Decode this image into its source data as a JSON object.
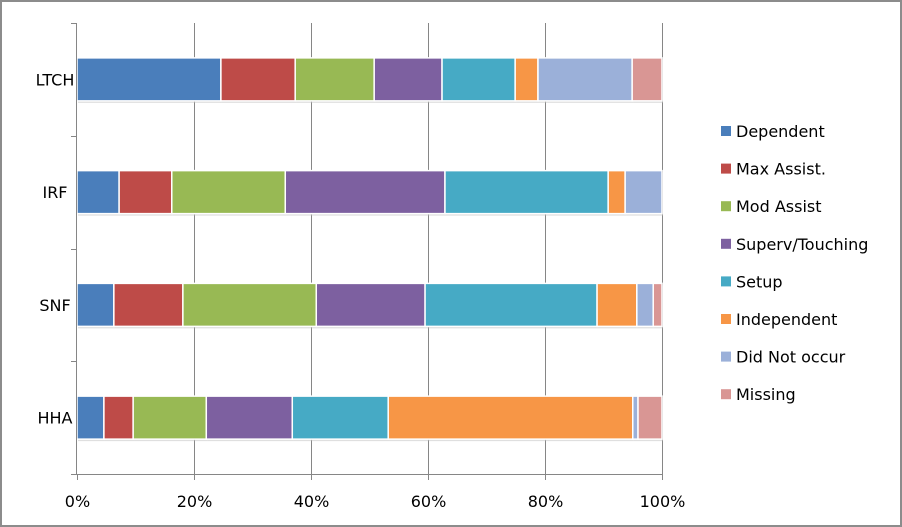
{
  "chart_data": {
    "type": "bar",
    "orientation": "horizontal",
    "stacked": "percent",
    "title": "",
    "xlabel": "",
    "ylabel": "",
    "xlim": [
      0,
      100
    ],
    "grid": true,
    "legend_position": "right",
    "categories": [
      "LTCH",
      "IRF",
      "SNF",
      "HHA"
    ],
    "x_ticks": [
      "0%",
      "20%",
      "40%",
      "60%",
      "80%",
      "100%"
    ],
    "series": [
      {
        "name": "Dependent",
        "color": "#4a7ebb",
        "values": [
          24.6,
          7.2,
          6.3,
          4.6
        ]
      },
      {
        "name": "Max Assist.",
        "color": "#be4b48",
        "values": [
          12.7,
          9.0,
          11.8,
          5.0
        ]
      },
      {
        "name": "Mod Assist",
        "color": "#98b954",
        "values": [
          13.5,
          19.4,
          22.8,
          12.5
        ]
      },
      {
        "name": "Superv/Touching",
        "color": "#7d60a0",
        "values": [
          11.6,
          27.3,
          18.6,
          14.7
        ]
      },
      {
        "name": "Setup",
        "color": "#46aac5",
        "values": [
          12.5,
          27.9,
          29.4,
          16.4
        ]
      },
      {
        "name": "Independent",
        "color": "#f79646",
        "values": [
          3.9,
          2.9,
          6.8,
          41.8
        ]
      },
      {
        "name": "Did Not occur",
        "color": "#9bb0d9",
        "values": [
          16.1,
          6.3,
          2.8,
          0.9
        ]
      },
      {
        "name": "Missing",
        "color": "#d99694",
        "values": [
          5.1,
          0.0,
          1.5,
          4.1
        ]
      }
    ]
  }
}
